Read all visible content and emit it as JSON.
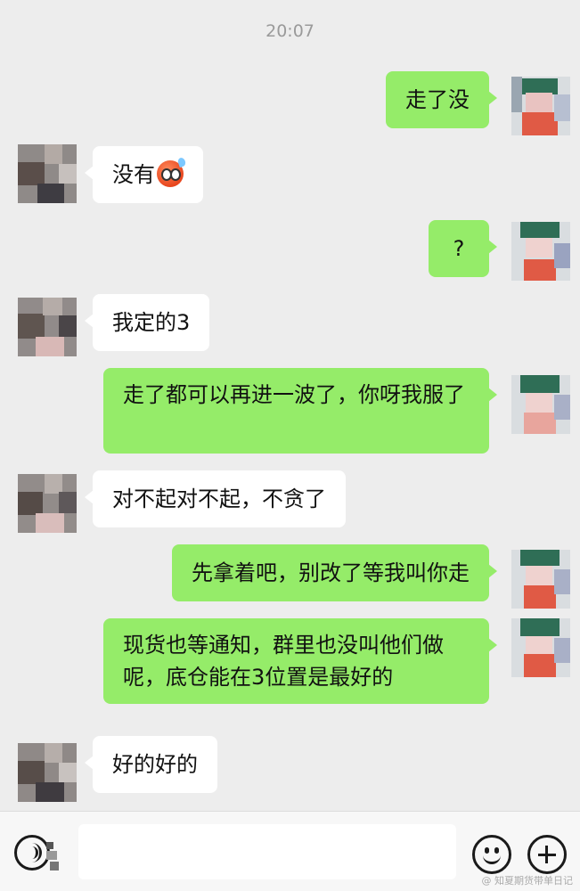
{
  "header": {
    "timestamp": "20:07"
  },
  "messages": [
    {
      "side": "right",
      "text": "走了没"
    },
    {
      "side": "left",
      "text": "没有",
      "emoji": "sweat-face-emoji"
    },
    {
      "side": "right",
      "text": "?"
    },
    {
      "side": "left",
      "text": "我定的3"
    },
    {
      "side": "right",
      "text": "走了都可以再进一波了，你呀我服了"
    },
    {
      "side": "left",
      "text": "对不起对不起，不贪了"
    },
    {
      "side": "right",
      "text": "先拿着吧，别改了等我叫你走"
    },
    {
      "side": "right",
      "text": "现货也等通知，群里也没叫他们做呢，底仓能在3位置是最好的"
    },
    {
      "side": "left",
      "text": "好的好的"
    }
  ],
  "input_bar": {
    "voice_icon": "voice-icon",
    "emoji_icon": "emoji-icon",
    "plus_icon": "plus-icon",
    "input_value": ""
  },
  "watermark": "@ 知夏期货带单日记",
  "colors": {
    "background": "#ededed",
    "sent_bubble": "#95ec69",
    "received_bubble": "#ffffff",
    "input_bar": "#f7f7f7"
  }
}
